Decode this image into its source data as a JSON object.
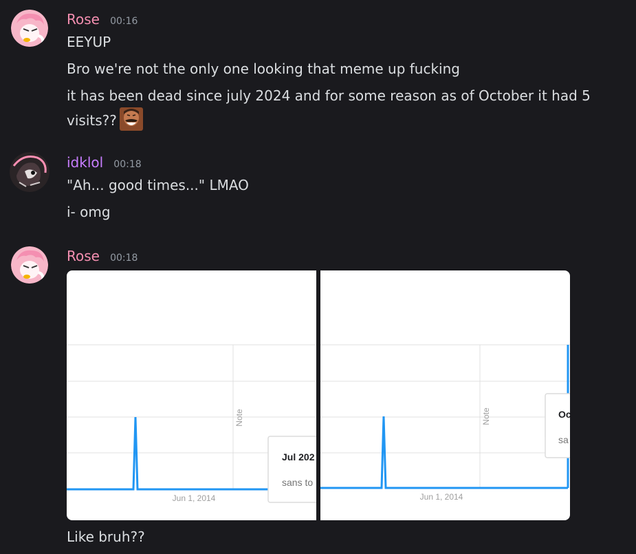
{
  "messages": [
    {
      "author": "Rose",
      "author_color": "#f48fb1",
      "time": "00:16",
      "lines": [
        "EEYUP",
        "Bro we're not the only one looking that meme up fucking",
        "it has been dead since july 2024 and for some reason as of October it had 5 visits??"
      ],
      "emoji": "laughing-man-emoji"
    },
    {
      "author": "idklol",
      "author_color": "#c77dff",
      "time": "00:18",
      "lines": [
        "\"Ah... good times...\" LMAO",
        "i- omg"
      ]
    },
    {
      "author": "Rose",
      "author_color": "#f48fb1",
      "time": "00:18",
      "attachments": [
        {
          "tick_label": "Jun 1, 2014",
          "note_label": "Note",
          "tooltip_title": "Jul 202",
          "tooltip_sub": "sans to",
          "spike_level": 0.5
        },
        {
          "tick_label": "Jun 1, 2014",
          "note_label": "Note",
          "tooltip_title": "Oc",
          "tooltip_sub": "sa",
          "spike_level": 0.5
        }
      ],
      "lines": [
        "Like bruh??"
      ]
    }
  ],
  "colors": {
    "line_blue": "#2196f3",
    "grid": "#e0e0e0"
  }
}
